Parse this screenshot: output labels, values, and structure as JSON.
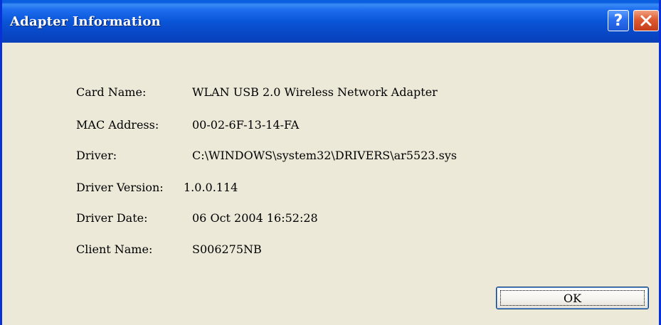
{
  "window": {
    "title": "Adapter Information",
    "help_label": "?",
    "accent_color": "#0a55d8"
  },
  "fields": [
    {
      "label": "Card Name:",
      "value": "WLAN USB 2.0 Wireless Network Adapter"
    },
    {
      "label": "MAC Address:",
      "value": "00-02-6F-13-14-FA"
    },
    {
      "label": "Driver:",
      "value": "C:\\WINDOWS\\system32\\DRIVERS\\ar5523.sys"
    },
    {
      "label": "Driver Version:",
      "value": "1.0.0.114"
    },
    {
      "label": "Driver Date:",
      "value": "06 Oct 2004 16:52:28"
    },
    {
      "label": "Client Name:",
      "value": "S006275NB"
    }
  ],
  "buttons": {
    "ok_label": "OK"
  },
  "icons": {
    "help": "question-mark-icon",
    "close": "close-icon"
  }
}
